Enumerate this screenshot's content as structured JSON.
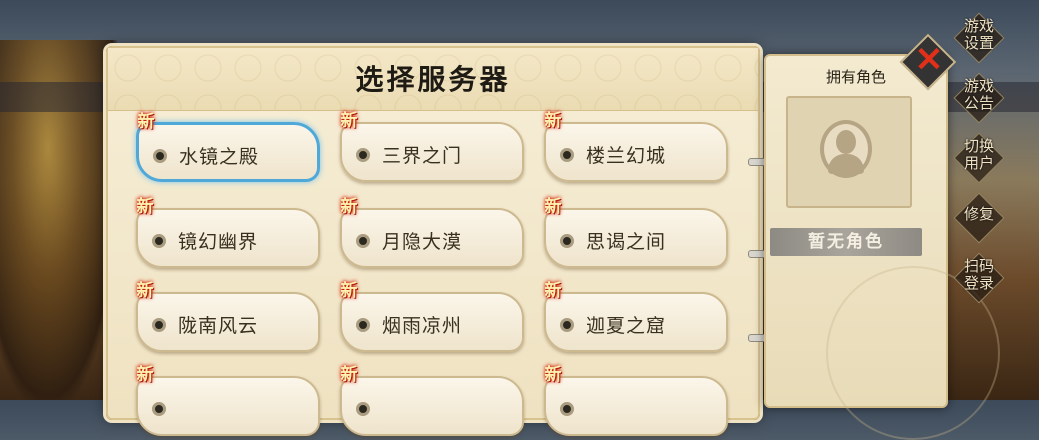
{
  "page": {
    "title": "选择服务器"
  },
  "servers": [
    {
      "name": "水镜之殿",
      "badge": "新",
      "selected": true
    },
    {
      "name": "三界之门",
      "badge": "新"
    },
    {
      "name": "楼兰幻城",
      "badge": "新"
    },
    {
      "name": "镜幻幽界",
      "badge": "新"
    },
    {
      "name": "月隐大漠",
      "badge": "新"
    },
    {
      "name": "思谒之间",
      "badge": "新"
    },
    {
      "name": "陇南风云",
      "badge": "新"
    },
    {
      "name": "烟雨凉州",
      "badge": "新"
    },
    {
      "name": "迦夏之窟",
      "badge": "新"
    },
    {
      "name": "",
      "badge": "新"
    },
    {
      "name": "",
      "badge": "新"
    },
    {
      "name": "",
      "badge": "新"
    }
  ],
  "side_panel": {
    "title": "拥有角色",
    "empty_label": "暂无角色"
  },
  "right_menu": [
    {
      "label": "游戏设置"
    },
    {
      "label": "游戏公告"
    },
    {
      "label": "切换用户"
    },
    {
      "label": "修复"
    },
    {
      "label": "扫码登录"
    }
  ],
  "colors": {
    "selected_border": "#4fa8d8",
    "badge_glow": "#e0320f",
    "close_x": "#e0301a"
  }
}
